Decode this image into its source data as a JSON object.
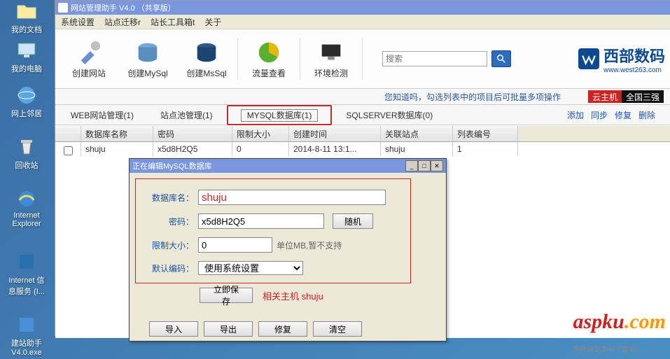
{
  "desktop": {
    "icons": [
      {
        "label": "我的文档"
      },
      {
        "label": "我的电脑"
      },
      {
        "label": "网上邻居"
      },
      {
        "label": "回收站"
      },
      {
        "label": "Internet Explorer"
      },
      {
        "label": "Internet 信息服务 (I..."
      },
      {
        "label": "建站助手 V4.0.exe"
      }
    ]
  },
  "main": {
    "title": "网站管理助手 V4.0 （共享版）",
    "menu": [
      "系统设置",
      "站点迁移r",
      "站长工具箱t",
      "关于"
    ],
    "toolbar": [
      {
        "label": "创建网站"
      },
      {
        "label": "创建MySql"
      },
      {
        "label": "创建MsSql"
      },
      {
        "label": "流量查看"
      },
      {
        "label": "环境检测"
      }
    ],
    "search": {
      "placeholder": "搜索"
    },
    "brand": {
      "name": "西部数码",
      "url": "www.west263.com"
    },
    "hint": "您知道吗，勾选列表中的项目后可批量多项操作",
    "promo": {
      "a": "云主机",
      "b": "全国三强"
    },
    "tabs": [
      {
        "label": "WEB网站管理(1)"
      },
      {
        "label": "站点池管理(1)"
      },
      {
        "label": "MYSQL数据库(1)",
        "active": true
      },
      {
        "label": "SQLSERVER数据库(0)"
      }
    ],
    "actions": [
      "添加",
      "同步",
      "修复",
      "删除"
    ],
    "grid": {
      "headers": [
        "",
        "数据库名称",
        "密码",
        "限制大小",
        "创建时间",
        "关联站点",
        "列表编号"
      ],
      "row": {
        "name": "shuju",
        "pwd": "x5d8H2Q5",
        "limit": "0",
        "time": "2014-8-11 13:1...",
        "site": "shuju",
        "idx": "1"
      }
    }
  },
  "dialog": {
    "title": "正在编辑MySQL数据库",
    "fields": {
      "db_name_lbl": "数据库名：",
      "db_name": "shuju",
      "pwd_lbl": "密码：",
      "pwd": "x5d8H2Q5",
      "random": "随机",
      "limit_lbl": "限制大小：",
      "limit": "0",
      "limit_note": "单位MB,暂不支持",
      "enc_lbl": "默认编码：",
      "enc": "使用系统设置"
    },
    "save": "立即保存",
    "related": "相关主机 shuju",
    "buttons": [
      "导入",
      "导出",
      "修复",
      "清空"
    ]
  },
  "watermark": {
    "name": "aspku",
    "tld": ".com",
    "sub": "免费网站源码下载站!"
  }
}
